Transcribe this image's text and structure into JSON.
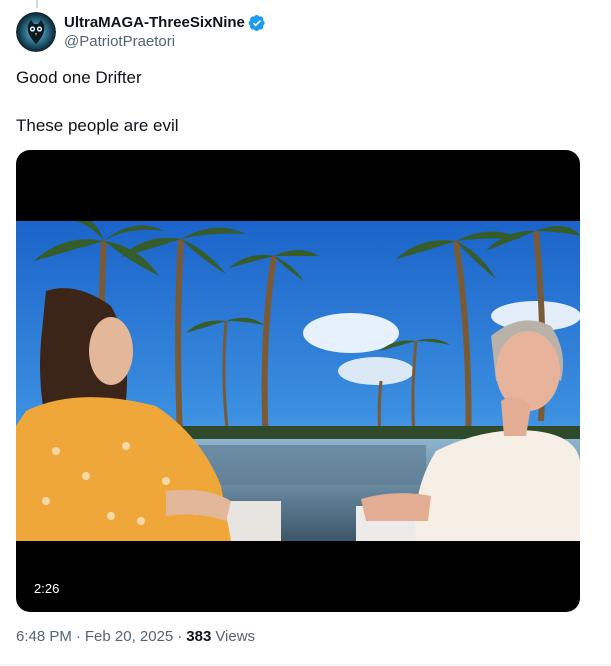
{
  "author": {
    "display_name": "UltraMAGA-ThreeSixNine",
    "handle": "@PatriotPraetori",
    "avatar_icon": "owl-avatar-icon",
    "verified": true,
    "verified_color": "#1d9bf0"
  },
  "tweet": {
    "lines": [
      "Good one Drifter",
      "These people are evil"
    ]
  },
  "media": {
    "type": "video",
    "duration": "2:26"
  },
  "meta": {
    "time": "6:48 PM",
    "separator": "·",
    "date": "Feb 20, 2025",
    "views_count": "383",
    "views_label": "Views"
  },
  "colors": {
    "text_primary": "#0f1419",
    "text_secondary": "#536471",
    "accent": "#1d9bf0"
  }
}
